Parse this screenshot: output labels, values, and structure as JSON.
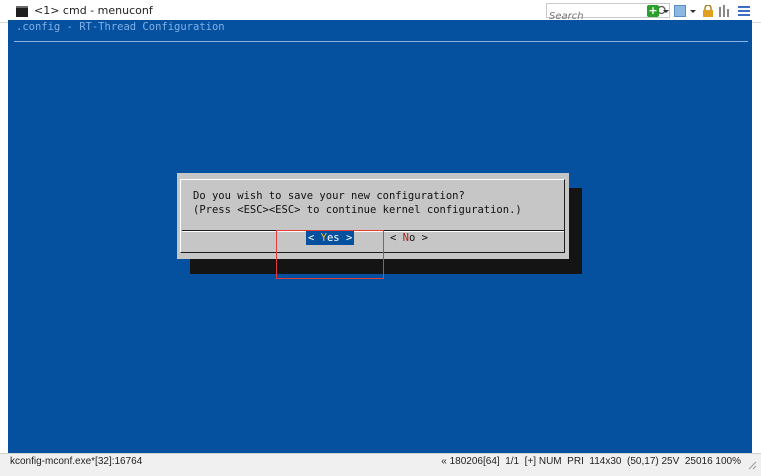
{
  "window": {
    "title": "<1> cmd - menuconf",
    "search_placeholder": "Search"
  },
  "terminal": {
    "header": ".config - RT-Thread Configuration",
    "background": "#0551a0"
  },
  "dialog": {
    "line1": "Do you wish to save your new configuration?",
    "line2": "(Press <ESC><ESC> to continue kernel configuration.)",
    "yes_left": "< ",
    "yes_hot": "Y",
    "yes_rest": "es",
    "yes_right": " >",
    "no_left": "< ",
    "no_hot": "N",
    "no_rest": "o",
    "no_right": " >"
  },
  "statusbar": {
    "left": "kconfig-mconf.exe*[32]:16764",
    "right": "« 180206[64]  1/1  [+] NUM  PRI  114x30  (50,17) 25V  25016 100%"
  },
  "icons": [
    "console-icon",
    "search-icon",
    "add-tab-icon",
    "dropdown-icon",
    "panel-icon",
    "lock-icon",
    "bars-icon",
    "menu-icon",
    "resize-grip-icon"
  ]
}
